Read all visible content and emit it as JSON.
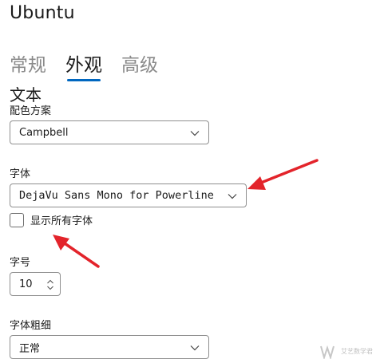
{
  "app": {
    "title": "Ubuntu"
  },
  "tabs": [
    {
      "label": "常规",
      "active": false
    },
    {
      "label": "外观",
      "active": true
    },
    {
      "label": "高级",
      "active": false
    }
  ],
  "section": {
    "title": "文本"
  },
  "color_scheme": {
    "label": "配色方案",
    "value": "Campbell"
  },
  "font_face": {
    "label": "字体",
    "value": "DejaVu Sans Mono for Powerline"
  },
  "show_all_fonts": {
    "label": "显示所有字体",
    "checked": false
  },
  "font_size": {
    "label": "字号",
    "value": "10"
  },
  "font_weight": {
    "label": "字体粗细",
    "value": "正常"
  },
  "watermark": {
    "text": "艾艺数学君"
  },
  "colors": {
    "accent": "#0067c0",
    "annotation_arrow": "#e3242b",
    "inactive_tab": "#8a8a8a"
  },
  "icons": {
    "dropdown": "chevron-down-icon",
    "stepper": "spinner-up-down-icon",
    "annotation": "red-arrow-icon"
  }
}
